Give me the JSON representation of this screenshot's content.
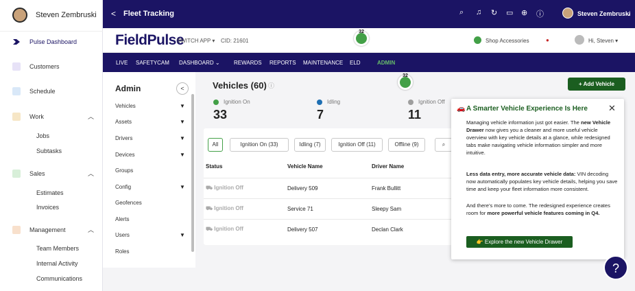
{
  "sidebar": {
    "user_name": "Steven Zembruski",
    "items": [
      {
        "label": "Pulse Dashboard",
        "icon": "pulse-icon",
        "color": "#1b1464"
      },
      {
        "label": "Customers",
        "icon": "customers-icon",
        "color": "#7b61c9"
      },
      {
        "label": "Schedule",
        "icon": "calendar-icon",
        "color": "#3f84d6"
      },
      {
        "label": "Work",
        "icon": "work-icon",
        "color": "#d69a2a"
      },
      {
        "label": "Sales",
        "icon": "sales-icon",
        "color": "#3b9a4a"
      },
      {
        "label": "Management",
        "icon": "management-icon",
        "color": "#e2762a"
      }
    ],
    "work_sub": [
      "Jobs",
      "Subtasks"
    ],
    "sales_sub": [
      "Estimates",
      "Invoices"
    ],
    "management_sub": [
      "Team Members",
      "Internal Activity",
      "Communications"
    ]
  },
  "topbar": {
    "back": "<",
    "title": "Fleet Tracking",
    "user": "Steven Zembruski"
  },
  "fp_header": {
    "logo": "FieldPulse",
    "switch_app": "SWITCH APP ▾",
    "cid": "CID: 21601",
    "badge_count": "32",
    "shop": "Shop Accessories",
    "greeting": "Hi, Steven ▾"
  },
  "nav": [
    "LIVE",
    "SAFETYCAM",
    "DASHBOARD ⌄",
    "REWARDS",
    "REPORTS",
    "MAINTENANCE",
    "ELD",
    "ADMIN"
  ],
  "admin": {
    "title": "Admin",
    "items": [
      "Vehicles",
      "Assets",
      "Drivers",
      "Devices",
      "Groups",
      "Config",
      "Geofences",
      "Alerts",
      "Users",
      "Roles"
    ]
  },
  "vehicles": {
    "heading": "Vehicles (60)",
    "add_button": "+ Add Vehicle",
    "badge_count": "32",
    "stats": [
      {
        "label": "Ignition On",
        "value": "33",
        "color": "#43a047"
      },
      {
        "label": "Idling",
        "value": "7",
        "color": "#1e6fb3"
      },
      {
        "label": "Ignition Off",
        "value": "11",
        "color": "#9e9e9e"
      }
    ],
    "filters": [
      "All",
      "Ignition On (33)",
      "Idling (7)",
      "Ignition Off (11)",
      "Offline (9)"
    ],
    "columns": [
      "Status",
      "Vehicle Name",
      "Driver Name"
    ],
    "rows": [
      {
        "status": "Ignition Off",
        "vehicle": "Delivery 509",
        "driver": "Frank Bullitt"
      },
      {
        "status": "Ignition Off",
        "vehicle": "Service 71",
        "driver": "Sleepy Sam"
      },
      {
        "status": "Ignition Off",
        "vehicle": "Delivery 507",
        "driver": "Declan Clark"
      }
    ]
  },
  "popup": {
    "title": "A Smarter Vehicle Experience Is Here",
    "p1_a": "Managing vehicle information just got easier. The ",
    "p1_b": "new Vehicle Drawer",
    "p1_c": " now gives you a cleaner and more useful vehicle overview with key vehicle details at a glance, while redesigned tabs make navigating vehicle information simpler and more intuitive.",
    "p2_a": "Less data entry, more accurate vehicle data:",
    "p2_b": " VIN decoding now automatically populates key vehicle details, helping you save time and keep your fleet information more consistent.",
    "p3_a": "And there’s more to come. The redesigned experience creates room for ",
    "p3_b": "more powerful vehicle features coming in Q4.",
    "button": "👉 Explore the new Vehicle Drawer"
  }
}
